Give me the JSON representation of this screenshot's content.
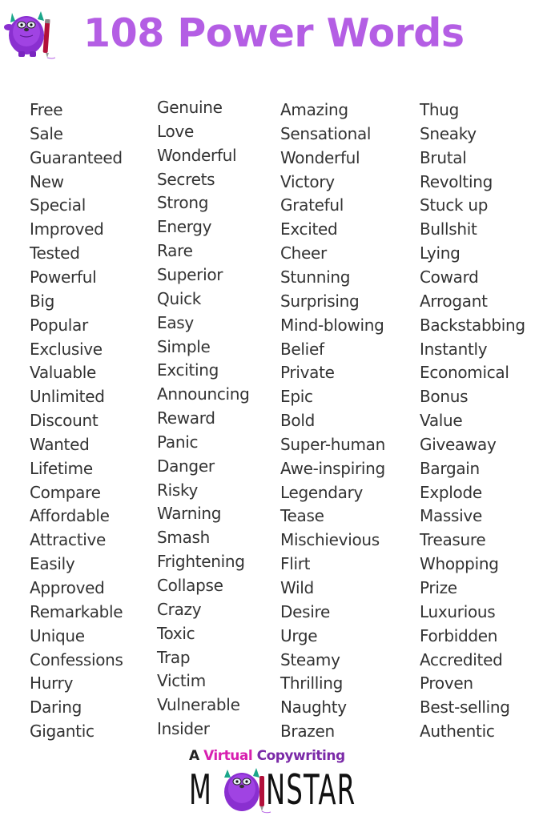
{
  "header": {
    "logo_icon": "monster-mascot-icon",
    "title": "108 Power Words",
    "title_color": "#b45ee4"
  },
  "columns": [
    {
      "words": [
        "Free",
        "Sale",
        "Guaranteed",
        "New",
        "Special",
        "Improved",
        "Tested",
        "Powerful",
        "Big",
        "Popular",
        "Exclusive",
        "Valuable",
        "Unlimited",
        "Discount",
        "Wanted",
        "Lifetime",
        "Compare",
        "Affordable",
        "Attractive",
        "Easily",
        "Approved",
        "Remarkable",
        "Unique",
        "Confessions",
        "Hurry",
        "Daring",
        "Gigantic"
      ]
    },
    {
      "words": [
        "Genuine",
        "Love",
        "Wonderful",
        "Secrets",
        "Strong",
        "Energy",
        "Rare",
        "Superior",
        "Quick",
        "Easy",
        "Simple",
        "Exciting",
        "Announcing",
        "Reward",
        "Panic",
        "Danger",
        "Risky",
        "Warning",
        "Smash",
        "Frightening",
        "Collapse",
        "Crazy",
        "Toxic",
        "Trap",
        "Victim",
        "Vulnerable",
        "Insider"
      ]
    },
    {
      "words": [
        "Amazing",
        "Sensational",
        "Wonderful",
        "Victory",
        "Grateful",
        "Excited",
        "Cheer",
        "Stunning",
        "Surprising",
        "Mind-blowing",
        "Belief",
        "Private",
        "Epic",
        "Bold",
        "Super-human",
        "Awe-inspiring",
        "Legendary",
        "Tease",
        "Mischievious",
        "Flirt",
        "Wild",
        "Desire",
        "Urge",
        "Steamy",
        "Thrilling",
        "Naughty",
        "Brazen"
      ]
    },
    {
      "words": [
        "Thug",
        "Sneaky",
        "Brutal",
        "Revolting",
        "Stuck up",
        "Bullshit",
        "Lying",
        "Coward",
        "Arrogant",
        "Backstabbing",
        "Instantly",
        "Economical",
        "Bonus",
        "Value",
        "Giveaway",
        "Bargain",
        "Explode",
        "Massive",
        "Treasure",
        "Whopping",
        "Prize",
        "Luxurious",
        "Forbidden",
        "Accredited",
        "Proven",
        "Best-selling",
        "Authentic"
      ]
    }
  ],
  "footer": {
    "logo_icon": "monster-mascot-icon",
    "line1_a": "A ",
    "line1_virtual": "Virtual",
    "line1_copywriting": " Copywriting",
    "brand_m": "M",
    "brand_rest": "NSTAR",
    "colors": {
      "virtual": "#d81fb0",
      "copywriting": "#7b2aa8"
    }
  }
}
